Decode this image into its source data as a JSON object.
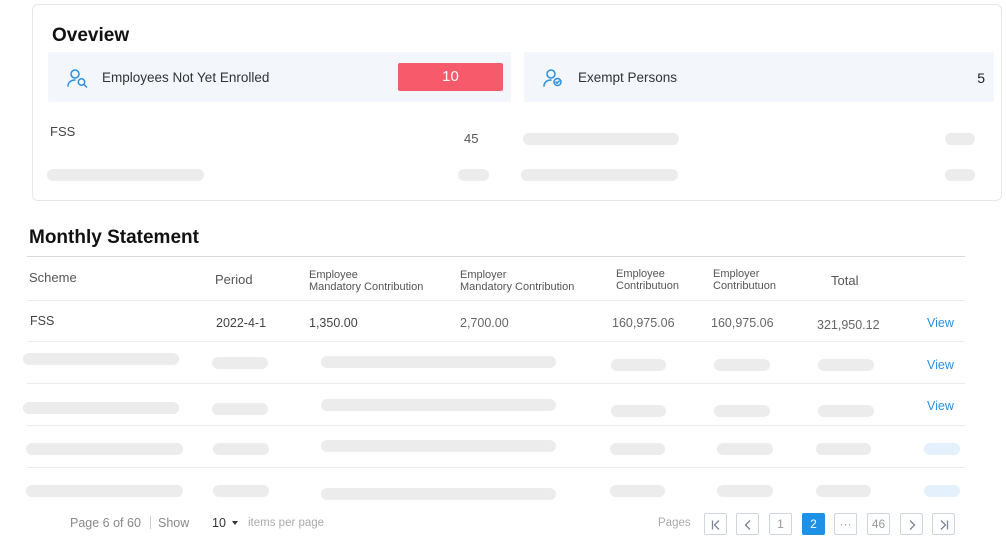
{
  "overview": {
    "title": "Oveview",
    "enrolled": {
      "label": "Employees Not Yet Enrolled",
      "value": "10",
      "icon": "user-search-icon",
      "badge_color": "#f75a6a"
    },
    "exempt": {
      "label": "Exempt Persons",
      "value": "5",
      "icon": "user-check-icon"
    },
    "fss_label": "FSS",
    "fss_value": "45"
  },
  "statement": {
    "title": "Monthly Statement",
    "headers": {
      "scheme": "Scheme",
      "period": "Period",
      "emp_mand_1": "Employee",
      "emp_mand_2": "Mandatory Contribution",
      "er_mand_1": "Employer",
      "er_mand_2": "Mandatory Contribution",
      "emp_contrib_1": "Employee",
      "emp_contrib_2": "Contributuon",
      "er_contrib_1": "Employer",
      "er_contrib_2": "Contributuon",
      "total": "Total"
    },
    "rows": [
      {
        "scheme": "FSS",
        "period": "2022-4-1",
        "emp_mand": "1,350.00",
        "er_mand": "2,700.00",
        "emp_contrib": "160,975.06",
        "er_contrib": "160,975.06",
        "total": "321,950.12",
        "action": "View"
      }
    ],
    "row2_action": "View",
    "row3_action": "View"
  },
  "pagination": {
    "page_info": "Page 6 of 60",
    "show_label": "Show",
    "per_page_value": "10",
    "per_page_suffix": "items per page",
    "pages_label": "Pages",
    "pages": [
      "1",
      "2",
      "···",
      "46"
    ],
    "active_page": "2",
    "accent_color": "#1e90e6"
  }
}
